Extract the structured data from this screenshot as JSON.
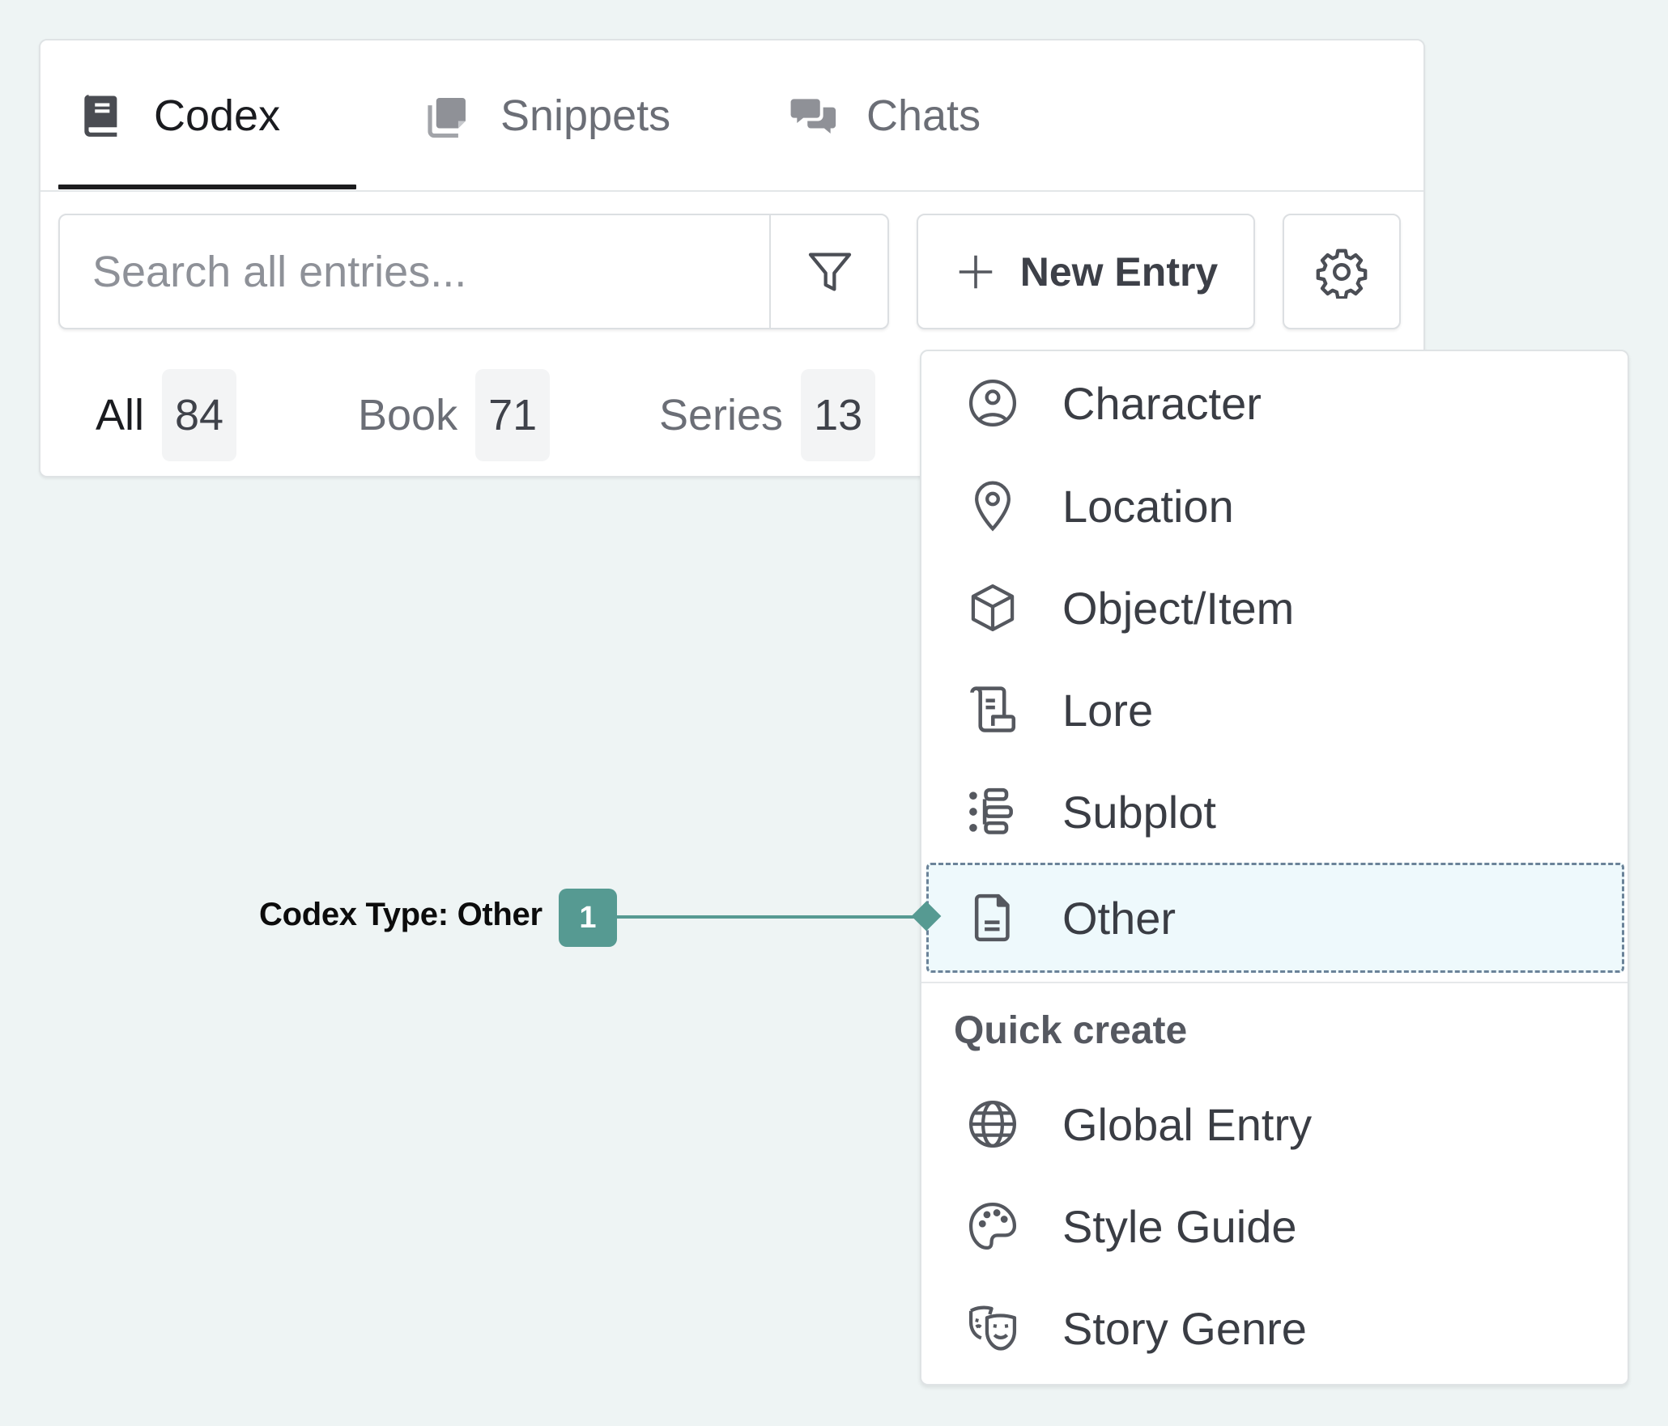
{
  "tabs": [
    {
      "label": "Codex",
      "icon": "book-icon",
      "active": true
    },
    {
      "label": "Snippets",
      "icon": "copy-icon",
      "active": false
    },
    {
      "label": "Chats",
      "icon": "chat-bubbles-icon",
      "active": false
    }
  ],
  "search": {
    "placeholder": "Search all entries...",
    "value": "",
    "filter_icon": "filter-icon"
  },
  "toolbar": {
    "new_entry_label": "New Entry",
    "new_entry_icon": "plus-icon",
    "settings_icon": "gear-icon"
  },
  "filters": [
    {
      "label": "All",
      "count": "84",
      "active": true
    },
    {
      "label": "Book",
      "count": "71",
      "active": false
    },
    {
      "label": "Series",
      "count": "13",
      "active": false
    }
  ],
  "dropdown": {
    "types": [
      {
        "label": "Character",
        "icon": "user-circle-icon"
      },
      {
        "label": "Location",
        "icon": "map-pin-icon"
      },
      {
        "label": "Object/Item",
        "icon": "box-icon"
      },
      {
        "label": "Lore",
        "icon": "scroll-icon"
      },
      {
        "label": "Subplot",
        "icon": "list-tree-icon"
      },
      {
        "label": "Other",
        "icon": "file-text-icon",
        "highlighted": true
      }
    ],
    "quick_create_heading": "Quick create",
    "quick_create": [
      {
        "label": "Global Entry",
        "icon": "globe-icon"
      },
      {
        "label": "Style Guide",
        "icon": "palette-icon"
      },
      {
        "label": "Story Genre",
        "icon": "theater-masks-icon"
      }
    ]
  },
  "annotation": {
    "label": "Codex Type: Other",
    "badge": "1",
    "color": "#569a92"
  },
  "colors": {
    "background": "#eef4f4",
    "highlight_fill": "#eef9fc",
    "highlight_border": "#6b8399",
    "accent": "#569a92"
  }
}
